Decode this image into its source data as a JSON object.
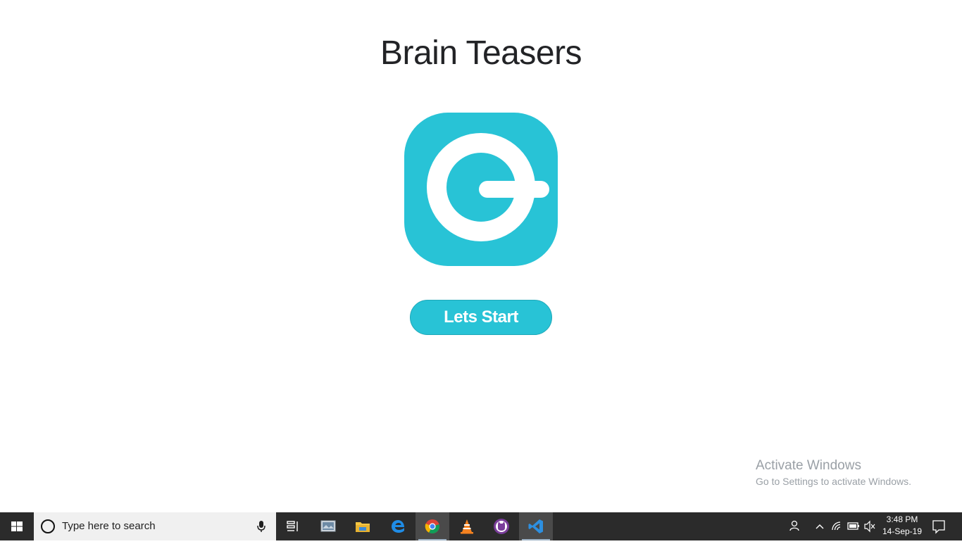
{
  "app": {
    "title": "Brain Teasers",
    "start_button_label": "Lets Start",
    "accent_color": "#28c3d6",
    "logo_icon": "power-dial-logo"
  },
  "watermark": {
    "line1": "Activate Windows",
    "line2": "Go to Settings to activate Windows."
  },
  "taskbar": {
    "start_icon": "windows-start-icon",
    "search_placeholder": "Type here to search",
    "apps": [
      {
        "name": "task-view-icon"
      },
      {
        "name": "photos-icon"
      },
      {
        "name": "file-explorer-icon"
      },
      {
        "name": "edge-icon"
      },
      {
        "name": "chrome-icon",
        "active": true
      },
      {
        "name": "vlc-icon"
      },
      {
        "name": "app-cat-icon"
      },
      {
        "name": "vscode-icon",
        "active": true
      }
    ],
    "tray": {
      "time": "3:48 PM",
      "date": "14-Sep-19"
    }
  }
}
